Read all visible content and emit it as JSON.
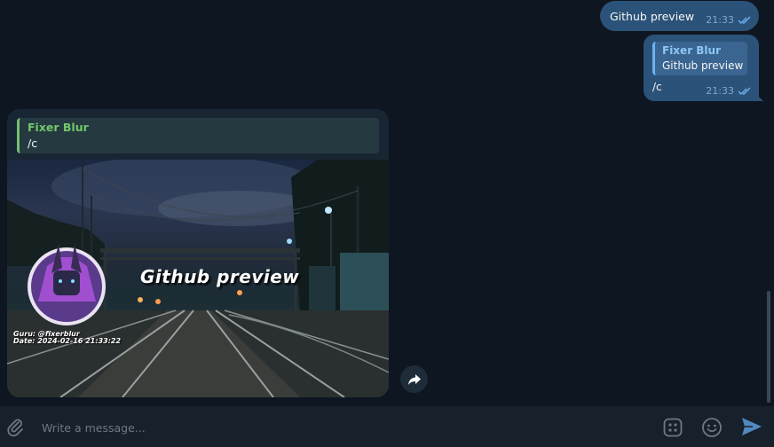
{
  "messages": {
    "outgoing_1": {
      "text": "Github preview",
      "time": "21:33"
    },
    "outgoing_2": {
      "reply": {
        "name": "Fixer Blur",
        "text": "Github preview"
      },
      "text": "/c",
      "time": "21:33"
    },
    "incoming_1": {
      "reply": {
        "name": "Fixer Blur",
        "text": "/c"
      },
      "image": {
        "title": "Github preview",
        "guru": "Guru: @fixerblur",
        "date": "Date: 2024-02-16 21:33:22"
      }
    }
  },
  "composer": {
    "placeholder": "Write a message..."
  },
  "icons": {
    "read": "double-check-icon",
    "forward": "forward-arrow-icon",
    "attach": "paperclip-icon",
    "commands": "bot-commands-icon",
    "emoji": "emoji-icon",
    "send": "send-icon"
  },
  "colors": {
    "chat_background": "#0e1621",
    "outgoing_bubble": "#2b5278",
    "incoming_bubble": "#182533",
    "accent": "#6ab3f3",
    "reply_green": "#74c76c"
  }
}
